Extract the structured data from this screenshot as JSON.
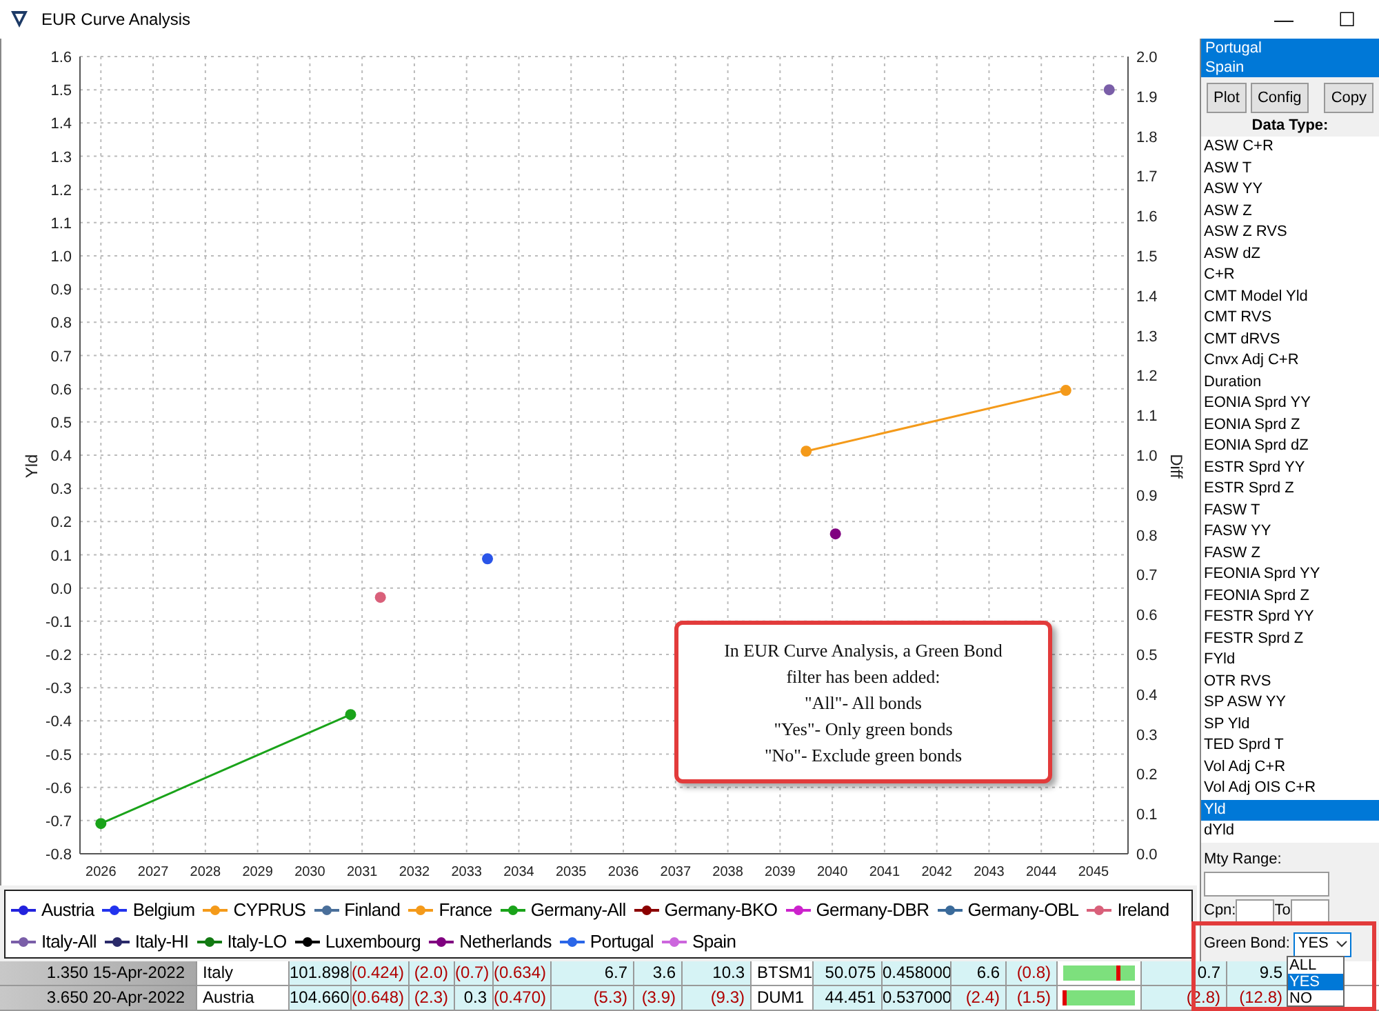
{
  "window": {
    "title": "EUR Curve Analysis",
    "controls": [
      "—",
      "☐"
    ]
  },
  "chart": {
    "chart_data": {
      "type": "line",
      "grid": true,
      "ylabel": "Yld",
      "y2label": "Diff",
      "xlim": [
        2025.6,
        2045.66
      ],
      "ylim": [
        -0.8,
        1.6
      ],
      "y2lim": [
        0,
        2.0
      ],
      "xticks": [
        {
          "value": 2026,
          "label": "2026"
        },
        {
          "value": 2027,
          "label": "2027"
        },
        {
          "value": 2028,
          "label": "2028"
        },
        {
          "value": 2029,
          "label": "2029"
        },
        {
          "value": 2030,
          "label": "2030"
        },
        {
          "value": 2031,
          "label": "2031"
        },
        {
          "value": 2032,
          "label": "2032"
        },
        {
          "value": 2033,
          "label": "2033"
        },
        {
          "value": 2034,
          "label": "2034"
        },
        {
          "value": 2035,
          "label": "2035"
        },
        {
          "value": 2036,
          "label": "2036"
        },
        {
          "value": 2037,
          "label": "2037"
        },
        {
          "value": 2038,
          "label": "2038"
        },
        {
          "value": 2039,
          "label": "2039"
        },
        {
          "value": 2040,
          "label": "2040"
        },
        {
          "value": 2041,
          "label": "2041"
        },
        {
          "value": 2042,
          "label": "2042"
        },
        {
          "value": 2043,
          "label": "2043"
        },
        {
          "value": 2044,
          "label": "2044"
        },
        {
          "value": 2045,
          "label": "2045"
        }
      ],
      "yticks": [
        {
          "value": 1.6,
          "label": "1.6"
        },
        {
          "value": 1.5,
          "label": "1.5"
        },
        {
          "value": 1.4,
          "label": "1.4"
        },
        {
          "value": 1.3,
          "label": "1.3"
        },
        {
          "value": 1.2,
          "label": "1.2"
        },
        {
          "value": 1.1,
          "label": "1.1"
        },
        {
          "value": 1.0,
          "label": "1.0"
        },
        {
          "value": 0.9,
          "label": "0.9"
        },
        {
          "value": 0.8,
          "label": "0.8"
        },
        {
          "value": 0.7,
          "label": "0.7"
        },
        {
          "value": 0.6,
          "label": "0.6"
        },
        {
          "value": 0.5,
          "label": "0.5"
        },
        {
          "value": 0.4,
          "label": "0.4"
        },
        {
          "value": 0.3,
          "label": "0.3"
        },
        {
          "value": 0.2,
          "label": "0.2"
        },
        {
          "value": 0.1,
          "label": "0.1"
        },
        {
          "value": 0,
          "label": "0.0"
        },
        {
          "value": -0.1,
          "label": "-0.1"
        },
        {
          "value": -0.2,
          "label": "-0.2"
        },
        {
          "value": -0.3,
          "label": "-0.3"
        },
        {
          "value": -0.4,
          "label": "-0.4"
        },
        {
          "value": -0.5,
          "label": "-0.5"
        },
        {
          "value": -0.6,
          "label": "-0.6"
        },
        {
          "value": -0.7,
          "label": "-0.7"
        },
        {
          "value": -0.8,
          "label": "-0.8"
        }
      ],
      "y2ticks": [
        {
          "value": 2.0,
          "label": "2.0"
        },
        {
          "value": 1.9,
          "label": "1.9"
        },
        {
          "value": 1.8,
          "label": "1.8"
        },
        {
          "value": 1.7,
          "label": "1.7"
        },
        {
          "value": 1.6,
          "label": "1.6"
        },
        {
          "value": 1.5,
          "label": "1.5"
        },
        {
          "value": 1.4,
          "label": "1.4"
        },
        {
          "value": 1.3,
          "label": "1.3"
        },
        {
          "value": 1.2,
          "label": "1.2"
        },
        {
          "value": 1.1,
          "label": "1.1"
        },
        {
          "value": 1.0,
          "label": "1.0"
        },
        {
          "value": 0.9,
          "label": "0.9"
        },
        {
          "value": 0.8,
          "label": "0.8"
        },
        {
          "value": 0.7,
          "label": "0.7"
        },
        {
          "value": 0.6,
          "label": "0.6"
        },
        {
          "value": 0.5,
          "label": "0.5"
        },
        {
          "value": 0.4,
          "label": "0.4"
        },
        {
          "value": 0.3,
          "label": "0.3"
        },
        {
          "value": 0.2,
          "label": "0.2"
        },
        {
          "value": 0.1,
          "label": "0.1"
        },
        {
          "value": 0,
          "label": "0.0"
        }
      ],
      "series": [
        {
          "color": "#1aa31a",
          "marker": "circle",
          "x": [
            2026.0,
            2030.78
          ],
          "values": [
            -0.709,
            -0.381
          ]
        },
        {
          "color": "#d9607a",
          "marker": "circle",
          "x": [
            2031.35
          ],
          "values": [
            -0.028
          ]
        },
        {
          "color": "#2a55e8",
          "marker": "circle",
          "x": [
            2033.4
          ],
          "values": [
            0.088
          ]
        },
        {
          "color": "#f49a1a",
          "marker": "circle",
          "x": [
            2039.5,
            2044.47
          ],
          "values": [
            0.412,
            0.595
          ]
        },
        {
          "color": "#800080",
          "marker": "circle",
          "x": [
            2040.06
          ],
          "values": [
            0.163
          ]
        },
        {
          "color": "#7a5ea8",
          "marker": "circle",
          "x": [
            2045.3
          ],
          "values": [
            1.5
          ]
        }
      ]
    },
    "callout": {
      "lines": [
        "In EUR Curve Analysis, a Green Bond",
        "filter has been added:",
        "\"All\"- All bonds",
        "\"Yes\"- Only green bonds",
        "\"No\"- Exclude green bonds"
      ]
    }
  },
  "legend": [
    {
      "label": "Austria",
      "color": "#2222dd"
    },
    {
      "label": "Belgium",
      "color": "#2233ee"
    },
    {
      "label": "CYPRUS",
      "color": "#f49a1a"
    },
    {
      "label": "Finland",
      "color": "#4a6f9a"
    },
    {
      "label": "France",
      "color": "#f49a1a"
    },
    {
      "label": "Germany-All",
      "color": "#1aa31a"
    },
    {
      "label": "Germany-BKO",
      "color": "#8b0000"
    },
    {
      "label": "Germany-DBR",
      "color": "#cc22cc"
    },
    {
      "label": "Germany-OBL",
      "color": "#3a6a9a"
    },
    {
      "label": "Ireland",
      "color": "#d9607a"
    },
    {
      "label": "Italy-All",
      "color": "#7a5ea8"
    },
    {
      "label": "Italy-HI",
      "color": "#2a2a6a"
    },
    {
      "label": "Italy-LO",
      "color": "#127a12"
    },
    {
      "label": "Luxembourg",
      "color": "#000000"
    },
    {
      "label": "Netherlands",
      "color": "#800080"
    },
    {
      "label": "Portugal",
      "color": "#2a66e8"
    },
    {
      "label": "Spain",
      "color": "#cc66dd"
    }
  ],
  "sidebar": {
    "countries": [
      {
        "label": "Portugal",
        "selected": true
      },
      {
        "label": "Spain",
        "selected": true
      }
    ],
    "buttons": [
      "Plot",
      "Config",
      "Copy"
    ],
    "data_type_label": "Data Type:",
    "data_types": [
      {
        "label": "ASW C+R",
        "selected": false
      },
      {
        "label": "ASW T",
        "selected": false
      },
      {
        "label": "ASW YY",
        "selected": false
      },
      {
        "label": "ASW Z",
        "selected": false
      },
      {
        "label": "ASW Z RVS",
        "selected": false
      },
      {
        "label": "ASW dZ",
        "selected": false
      },
      {
        "label": "C+R",
        "selected": false
      },
      {
        "label": "CMT Model Yld",
        "selected": false
      },
      {
        "label": "CMT RVS",
        "selected": false
      },
      {
        "label": "CMT dRVS",
        "selected": false
      },
      {
        "label": "Cnvx Adj C+R",
        "selected": false
      },
      {
        "label": "Duration",
        "selected": false
      },
      {
        "label": "EONIA Sprd YY",
        "selected": false
      },
      {
        "label": "EONIA Sprd Z",
        "selected": false
      },
      {
        "label": "EONIA Sprd dZ",
        "selected": false
      },
      {
        "label": "ESTR Sprd YY",
        "selected": false
      },
      {
        "label": "ESTR Sprd Z",
        "selected": false
      },
      {
        "label": "FASW T",
        "selected": false
      },
      {
        "label": "FASW YY",
        "selected": false
      },
      {
        "label": "FASW Z",
        "selected": false
      },
      {
        "label": "FEONIA Sprd YY",
        "selected": false
      },
      {
        "label": "FEONIA Sprd Z",
        "selected": false
      },
      {
        "label": "FESTR Sprd YY",
        "selected": false
      },
      {
        "label": "FESTR Sprd Z",
        "selected": false
      },
      {
        "label": "FYld",
        "selected": false
      },
      {
        "label": "OTR RVS",
        "selected": false
      },
      {
        "label": "SP ASW YY",
        "selected": false
      },
      {
        "label": "SP Yld",
        "selected": false
      },
      {
        "label": "TED Sprd T",
        "selected": false
      },
      {
        "label": "Vol Adj C+R",
        "selected": false
      },
      {
        "label": "Vol Adj OIS C+R",
        "selected": false
      },
      {
        "label": "Yld",
        "selected": true
      },
      {
        "label": "dYld",
        "selected": false
      }
    ],
    "mty_range_label": "Mty Range:",
    "cpn_label": "Cpn:",
    "to_label": "To",
    "green_bond": {
      "label": "Green Bond:",
      "value": "YES",
      "options": [
        {
          "label": "ALL",
          "selected": false
        },
        {
          "label": "YES",
          "selected": true
        },
        {
          "label": "NO",
          "selected": false
        }
      ]
    }
  },
  "table": {
    "rows": [
      {
        "cells": [
          {
            "kind": "head",
            "text": "1.350 15-Apr-2022",
            "red": false
          },
          {
            "kind": "text",
            "text": "Italy",
            "red": false
          },
          {
            "kind": "num",
            "text": "101.898",
            "red": false
          },
          {
            "kind": "num",
            "text": "(0.424)",
            "red": true
          },
          {
            "kind": "num",
            "text": "(2.0)",
            "red": true
          },
          {
            "kind": "num",
            "text": "(0.7)",
            "red": true
          },
          {
            "kind": "num",
            "text": "(0.634)",
            "red": true
          },
          {
            "kind": "num",
            "text": "6.7",
            "red": false
          },
          {
            "kind": "num",
            "text": "3.6",
            "red": false
          },
          {
            "kind": "num",
            "text": "10.3",
            "red": false
          },
          {
            "kind": "text",
            "text": "BTSM1",
            "red": false
          },
          {
            "kind": "num",
            "text": "50.075",
            "red": false
          },
          {
            "kind": "num",
            "text": "0.458000",
            "red": false
          },
          {
            "kind": "num",
            "text": "6.6",
            "red": false
          },
          {
            "kind": "num",
            "text": "(0.8)",
            "red": true
          },
          {
            "kind": "bar",
            "level": 0.77
          },
          {
            "kind": "num",
            "text": "0.7",
            "red": false
          },
          {
            "kind": "num",
            "text": "9.5",
            "red": false
          }
        ]
      },
      {
        "cells": [
          {
            "kind": "head",
            "text": "3.650 20-Apr-2022",
            "red": false
          },
          {
            "kind": "text",
            "text": "Austria",
            "red": false
          },
          {
            "kind": "num",
            "text": "104.660",
            "red": false
          },
          {
            "kind": "num",
            "text": "(0.648)",
            "red": true
          },
          {
            "kind": "num",
            "text": "(2.3)",
            "red": true
          },
          {
            "kind": "num",
            "text": "0.3",
            "red": false
          },
          {
            "kind": "num",
            "text": "(0.470)",
            "red": true
          },
          {
            "kind": "num",
            "text": "(5.3)",
            "red": true
          },
          {
            "kind": "num",
            "text": "(3.9)",
            "red": true
          },
          {
            "kind": "num",
            "text": "(9.3)",
            "red": true
          },
          {
            "kind": "text",
            "text": "DUM1",
            "red": false
          },
          {
            "kind": "num",
            "text": "44.451",
            "red": false
          },
          {
            "kind": "num",
            "text": "0.537000",
            "red": false
          },
          {
            "kind": "num",
            "text": "(2.4)",
            "red": true
          },
          {
            "kind": "num",
            "text": "(1.5)",
            "red": true
          },
          {
            "kind": "bar",
            "level": 0.02
          },
          {
            "kind": "num",
            "text": "(2.8)",
            "red": true
          },
          {
            "kind": "num",
            "text": "(12.8)",
            "red": true
          }
        ]
      }
    ]
  }
}
